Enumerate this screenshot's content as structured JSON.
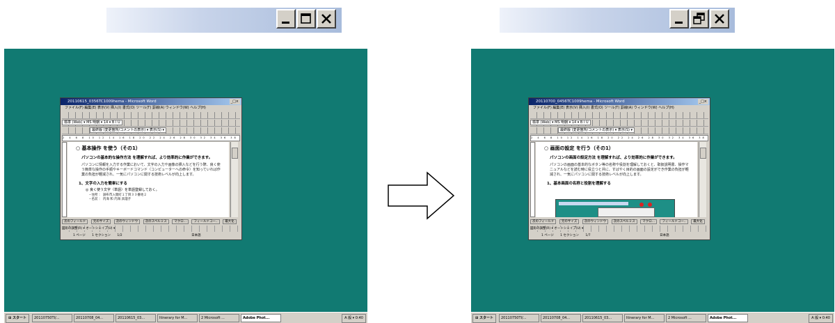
{
  "title_buttons": {
    "left": {
      "minimize": "minimize",
      "maximize": "maximize",
      "close": "close"
    },
    "right": {
      "minimize": "minimize",
      "restore": "restore",
      "close": "close"
    }
  },
  "screens": {
    "left": {
      "window_title": "20110615_0356TC1009hema - Microsoft Word",
      "menu": "ファイル(F)  編集(E)  表示(V)  挿入(I)  書式(O)  ツール(T)  罫線(A)  ウィンドウ(W)  ヘルプ(H)",
      "toolbar_font": "標準 (Web) ▾  MS 明朝  ▾ 14 ▾  B  I  U",
      "toolbar_review": "最終版 (変更箇所/コメントの表示) ▾  表示(S) ▾",
      "ruler": "2 4 6 8 10 12 14 16 18 20 22 24 26 28 30 32 34 36 38 40 42 44 46",
      "heading": "○ 基本操作 を使う（その1）",
      "subheading": "パソコンの基本的な操作方法 を理解すれば、より効率的に作業ができます。",
      "body": "パソコンに情報を入力する作業において、文字の入力や画像の挿入などを行う際、良く使う簡単な操作の手順やキーボードコマンド（コンピューターへの命令）を知っていれば作業の負担が軽減され、一気にパソコンに関する技術レベルが向上します。",
      "list_heading": "1、文字の入力を簡単にする",
      "list_item": "◎ 良く使う文字（単語）を単語登録しておく。",
      "list_sub1": "・住所 ： 調布市入間町１丁目３３番地２",
      "list_sub2": "・名前 ： 内海 和  内海 具理子",
      "status_fields": [
        "次のフィールド",
        "元のサイズ",
        "次のウィンドウ",
        "次のスペルミス",
        "マクロ...",
        "フィールドコー..",
        "最大化"
      ],
      "draw_toolbar": "図形の調整(R) ▾  オートシェイプ(U) ▾",
      "status_bar": [
        "1 ページ",
        "1 セクション",
        "1/2",
        "日本語"
      ]
    },
    "right": {
      "window_title": "20110700_0456TC1009hema - Microsoft Word",
      "menu": "ファイル(F)  編集(E)  表示(V)  挿入(I)  書式(O)  ツール(T)  罫線(A)  ウィンドウ(W)  ヘルプ(H)",
      "toolbar_font": "標準 (Web) ▾  MS 明朝  ▾ 14 ▾  B  I  U",
      "toolbar_review": "最終版 (変更箇所/コメントの表示) ▾  表示(S) ▾",
      "ruler": "2 4 6 8 10 12 14 16 18 20 22 24 26 28 30 32 34 36 38 40 42 44 46",
      "heading": "○ 画面の設定 を行う（その1）",
      "subheading": "パソコンの画面の設定方法 を理解すれば、より効率的に作業ができます。",
      "body": "パソコンの画面の基本的なボタン等の名称や役割を理解しておくと、取扱説明書、操作マニュアルなどを読む時に役立つと共に、すばやく目的の画面の設定ができ作業の負担が軽減され、一気にパソコンに関する技術レベルが向上します。",
      "list_heading": "1、基本画面の名称と役割を理解する",
      "status_fields": [
        "次のフィールド",
        "元のサイズ",
        "次のウィンドウ",
        "次のスペルミス",
        "マクロ...",
        "フィールドコー..",
        "最大化"
      ],
      "draw_toolbar": "図形の調整(R) ▾  オートシェイプ(U) ▾",
      "status_bar": [
        "1 ページ",
        "1 セクション",
        "1/7",
        "日本語"
      ]
    }
  },
  "taskbar": {
    "start": "スタート",
    "items": [
      "20110750TI/...",
      "20110708_04...",
      "20110615_03...",
      "Itinerary for M...",
      "2 Microsoft ...",
      "Adobe Phot..."
    ],
    "active_index": 5,
    "tray": "A 般 ▾  0:40"
  },
  "colors": {
    "desktop": "#117a72",
    "title_gradient_start": "#0a246a",
    "button_face": "#d4d0c8"
  }
}
